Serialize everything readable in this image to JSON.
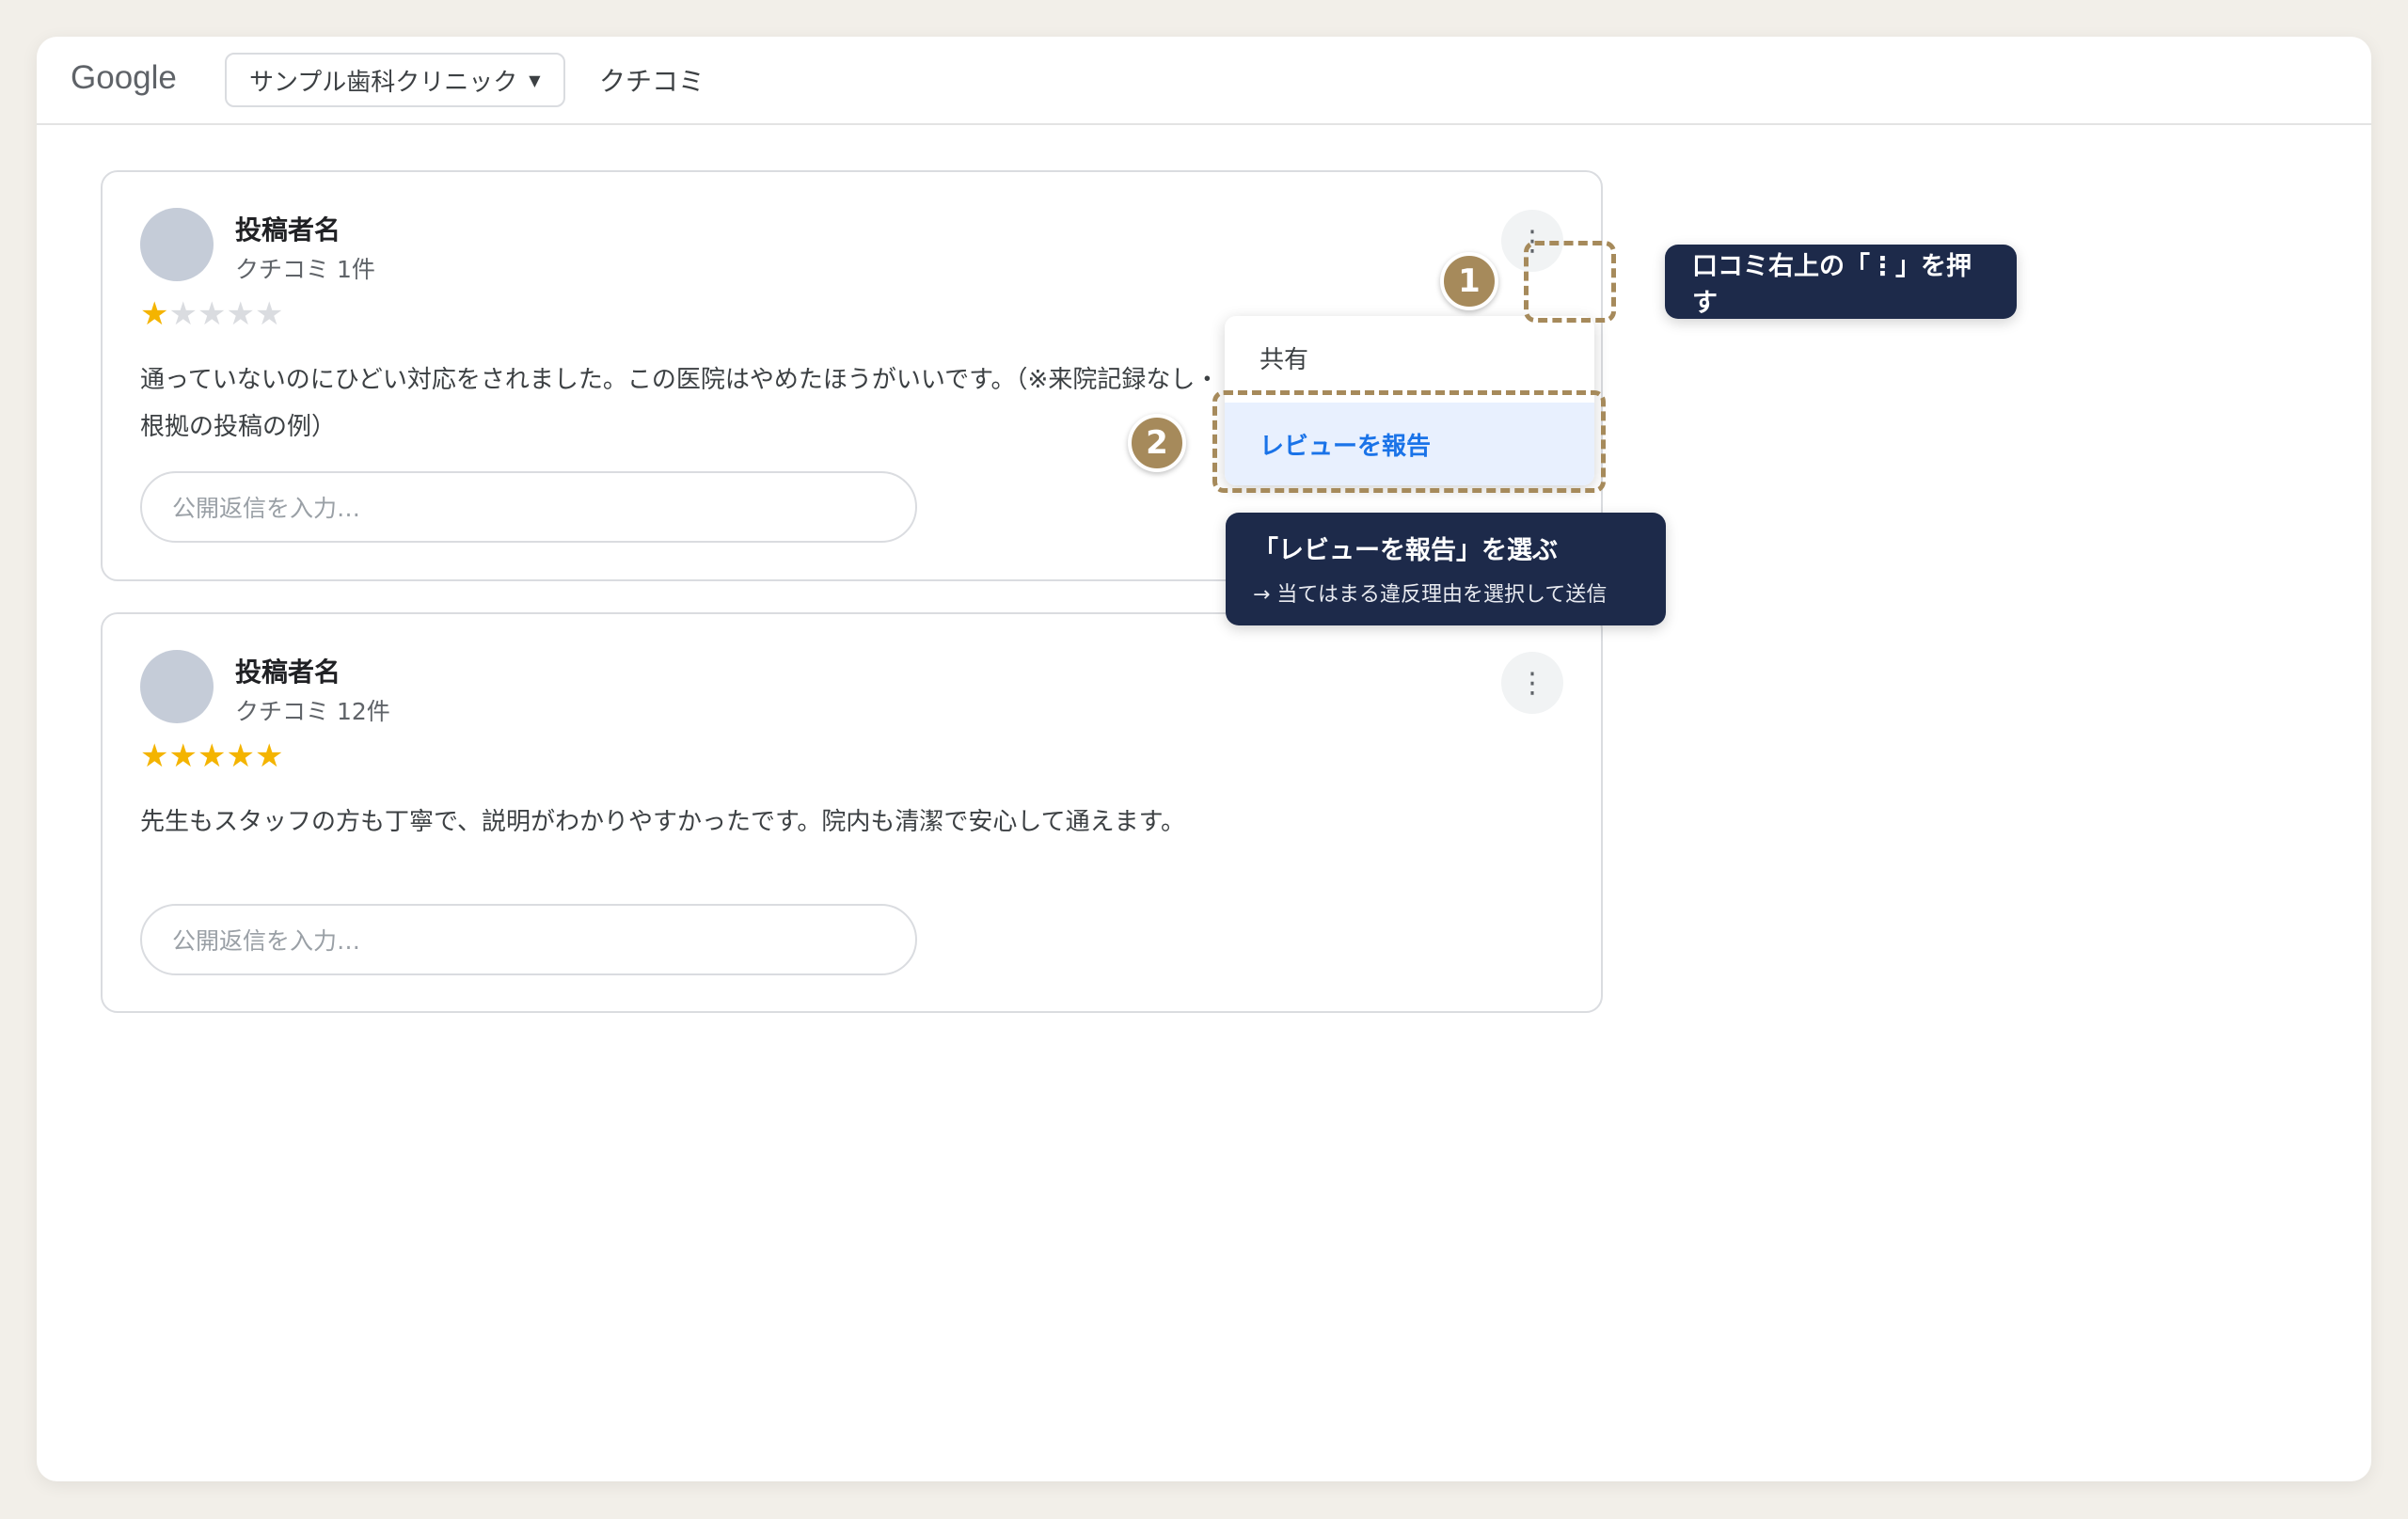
{
  "header": {
    "logo": "Google",
    "business_select": "サンプル歯科クリニック",
    "reviews_tab": "クチコミ"
  },
  "reviews": [
    {
      "author": "投稿者名",
      "count": "クチコミ 1件",
      "rating": 1,
      "max_rating": 5,
      "text": "通っていないのにひどい対応をされました。この医院はやめたほうがいいです。（※来院記録なし・根拠の投稿の例）",
      "reply_placeholder": "公開返信を入力…"
    },
    {
      "author": "投稿者名",
      "count": "クチコミ 12件",
      "rating": 5,
      "max_rating": 5,
      "text": "先生もスタッフの方も丁寧で、説明がわかりやすかったです。院内も清潔で安心して通えます。",
      "reply_placeholder": "公開返信を入力…"
    }
  ],
  "menu": {
    "share": "共有",
    "report": "レビューを報告"
  },
  "annotations": {
    "step1_badge": "1",
    "step2_badge": "2",
    "step1_text": "口コミ右上の「⋮」を押す",
    "step2_title": "「レビューを報告」を選ぶ",
    "step2_sub": "→ 当てはまる違反理由を選択して送信"
  },
  "colors": {
    "accent": "#a68a5b",
    "callout_bg": "#1d2a4a",
    "link_blue": "#1a73e8",
    "star": "#f4b400"
  }
}
